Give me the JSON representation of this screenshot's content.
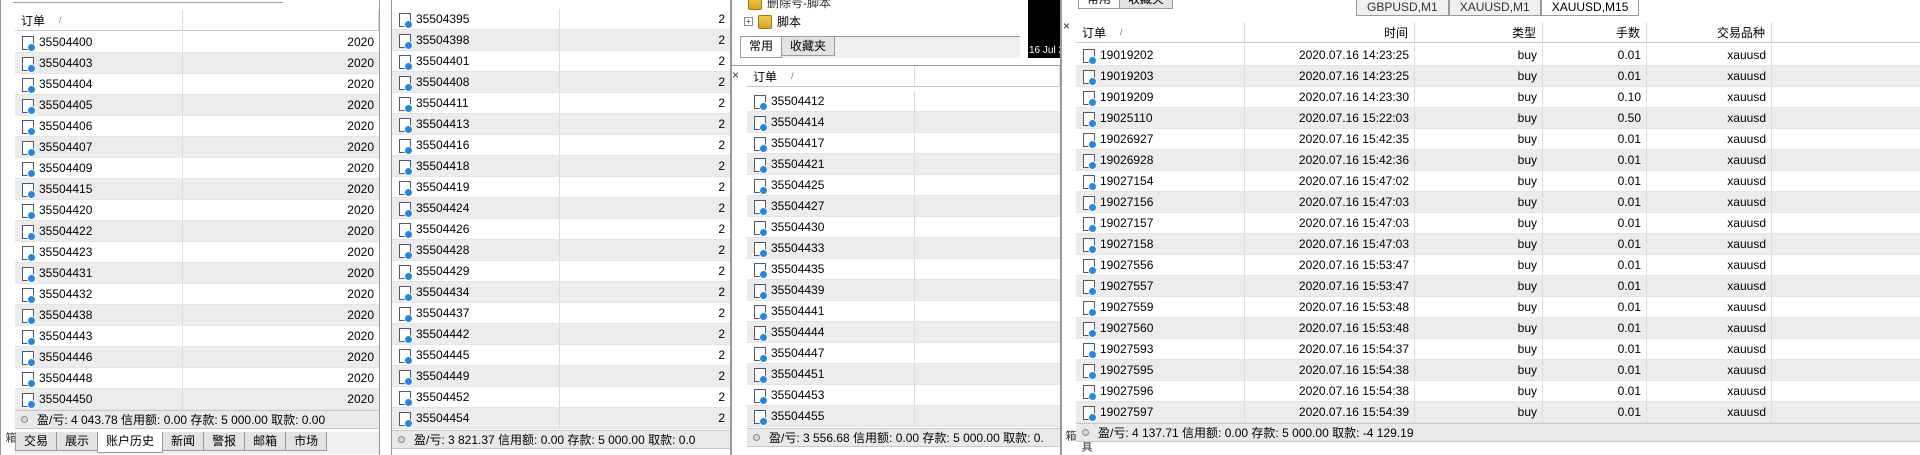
{
  "panel1": {
    "header": {
      "order": "订单"
    },
    "rows": [
      {
        "order": "35504400",
        "time": "2020"
      },
      {
        "order": "35504403",
        "time": "2020"
      },
      {
        "order": "35504404",
        "time": "2020"
      },
      {
        "order": "35504405",
        "time": "2020"
      },
      {
        "order": "35504406",
        "time": "2020"
      },
      {
        "order": "35504407",
        "time": "2020"
      },
      {
        "order": "35504409",
        "time": "2020"
      },
      {
        "order": "35504415",
        "time": "2020"
      },
      {
        "order": "35504420",
        "time": "2020"
      },
      {
        "order": "35504422",
        "time": "2020"
      },
      {
        "order": "35504423",
        "time": "2020"
      },
      {
        "order": "35504431",
        "time": "2020"
      },
      {
        "order": "35504432",
        "time": "2020"
      },
      {
        "order": "35504438",
        "time": "2020"
      },
      {
        "order": "35504443",
        "time": "2020"
      },
      {
        "order": "35504446",
        "time": "2020"
      },
      {
        "order": "35504448",
        "time": "2020"
      },
      {
        "order": "35504450",
        "time": "2020"
      }
    ],
    "footer": "盈/亏: 4 043.78  信用额: 0.00  存款: 5 000.00  取款: 0.00",
    "tabs": [
      "交易",
      "展示",
      "账户历史",
      "新闻",
      "警报",
      "邮箱",
      "市场"
    ],
    "side_label": "工具箱"
  },
  "panel2": {
    "rows": [
      "35504395",
      "35504398",
      "35504401",
      "35504408",
      "35504411",
      "35504413",
      "35504416",
      "35504418",
      "35504419",
      "35504424",
      "35504426",
      "35504428",
      "35504429",
      "35504434",
      "35504437",
      "35504442",
      "35504445",
      "35504449",
      "35504452",
      "35504454"
    ],
    "tail": "2",
    "footer": "盈/亏: 3 821.37  信用额: 0.00  存款: 5 000.00  取款: 0.0"
  },
  "navigator": {
    "item_partial": "删除号-脚本",
    "item_scripts": "脚本",
    "tabs": [
      "常用",
      "收藏夹"
    ],
    "chart_date": "16 Jul 2"
  },
  "panel3": {
    "header": {
      "order": "订单"
    },
    "rows": [
      "35504412",
      "35504414",
      "35504417",
      "35504421",
      "35504425",
      "35504427",
      "35504430",
      "35504433",
      "35504435",
      "35504439",
      "35504441",
      "35504444",
      "35504447",
      "35504451",
      "35504453",
      "35504455"
    ],
    "footer": "盈/亏: 3 556.68  信用额: 0.00  存款: 5 000.00  取款: 0."
  },
  "panel4": {
    "chart_tabs": [
      "GBPUSD,M1",
      "XAUUSD,M1",
      "XAUUSD,M15"
    ],
    "partial_tabs": [
      "常用",
      "收藏夹"
    ],
    "header": {
      "order": "订单",
      "time": "时间",
      "type": "类型",
      "lots": "手数",
      "symbol": "交易品种"
    },
    "rows": [
      {
        "order": "19019202",
        "time": "2020.07.16 14:23:25",
        "type": "buy",
        "lots": "0.01",
        "symbol": "xauusd"
      },
      {
        "order": "19019203",
        "time": "2020.07.16 14:23:25",
        "type": "buy",
        "lots": "0.01",
        "symbol": "xauusd"
      },
      {
        "order": "19019209",
        "time": "2020.07.16 14:23:30",
        "type": "buy",
        "lots": "0.10",
        "symbol": "xauusd"
      },
      {
        "order": "19025110",
        "time": "2020.07.16 15:22:03",
        "type": "buy",
        "lots": "0.50",
        "symbol": "xauusd"
      },
      {
        "order": "19026927",
        "time": "2020.07.16 15:42:35",
        "type": "buy",
        "lots": "0.01",
        "symbol": "xauusd"
      },
      {
        "order": "19026928",
        "time": "2020.07.16 15:42:36",
        "type": "buy",
        "lots": "0.01",
        "symbol": "xauusd"
      },
      {
        "order": "19027154",
        "time": "2020.07.16 15:47:02",
        "type": "buy",
        "lots": "0.01",
        "symbol": "xauusd"
      },
      {
        "order": "19027156",
        "time": "2020.07.16 15:47:03",
        "type": "buy",
        "lots": "0.01",
        "symbol": "xauusd"
      },
      {
        "order": "19027157",
        "time": "2020.07.16 15:47:03",
        "type": "buy",
        "lots": "0.01",
        "symbol": "xauusd"
      },
      {
        "order": "19027158",
        "time": "2020.07.16 15:47:03",
        "type": "buy",
        "lots": "0.01",
        "symbol": "xauusd"
      },
      {
        "order": "19027556",
        "time": "2020.07.16 15:53:47",
        "type": "buy",
        "lots": "0.01",
        "symbol": "xauusd"
      },
      {
        "order": "19027557",
        "time": "2020.07.16 15:53:47",
        "type": "buy",
        "lots": "0.01",
        "symbol": "xauusd"
      },
      {
        "order": "19027559",
        "time": "2020.07.16 15:53:48",
        "type": "buy",
        "lots": "0.01",
        "symbol": "xauusd"
      },
      {
        "order": "19027560",
        "time": "2020.07.16 15:53:48",
        "type": "buy",
        "lots": "0.01",
        "symbol": "xauusd"
      },
      {
        "order": "19027593",
        "time": "2020.07.16 15:54:37",
        "type": "buy",
        "lots": "0.01",
        "symbol": "xauusd"
      },
      {
        "order": "19027595",
        "time": "2020.07.16 15:54:38",
        "type": "buy",
        "lots": "0.01",
        "symbol": "xauusd"
      },
      {
        "order": "19027596",
        "time": "2020.07.16 15:54:38",
        "type": "buy",
        "lots": "0.01",
        "symbol": "xauusd"
      },
      {
        "order": "19027597",
        "time": "2020.07.16 15:54:39",
        "type": "buy",
        "lots": "0.01",
        "symbol": "xauusd"
      }
    ],
    "footer": "盈/亏: 4 137.71  信用额: 0.00  存款: 5 000.00  取款: -4 129.19",
    "side_label": "工具箱"
  },
  "colors": {
    "alt_row": "#ececec",
    "footer_bg": "#e9e9e9",
    "icon_blue": "#2a86d8",
    "chart_bg": "#000000"
  }
}
